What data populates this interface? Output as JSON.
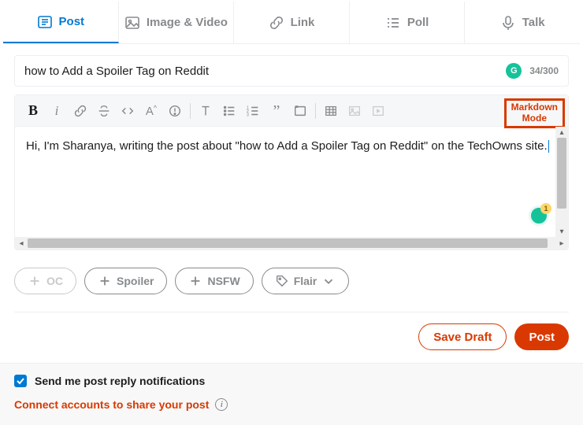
{
  "tabs": {
    "post": "Post",
    "image_video": "Image & Video",
    "link": "Link",
    "poll": "Poll",
    "talk": "Talk"
  },
  "title": {
    "value": "how to Add a Spoiler Tag on Reddit",
    "char_count": "34/300"
  },
  "markdown_label_line1": "Markdown",
  "markdown_label_line2": "Mode",
  "body_text": "Hi, I'm Sharanya, writing the post about \"how to Add a Spoiler Tag on Reddit\" on the TechOwns site.",
  "pills": {
    "oc": "OC",
    "spoiler": "Spoiler",
    "nsfw": "NSFW",
    "flair": "Flair"
  },
  "actions": {
    "save_draft": "Save Draft",
    "post": "Post"
  },
  "footer": {
    "notify": "Send me post reply notifications",
    "connect": "Connect accounts to share your post"
  },
  "grammarly_badge": "G",
  "grammarly_count": "1"
}
